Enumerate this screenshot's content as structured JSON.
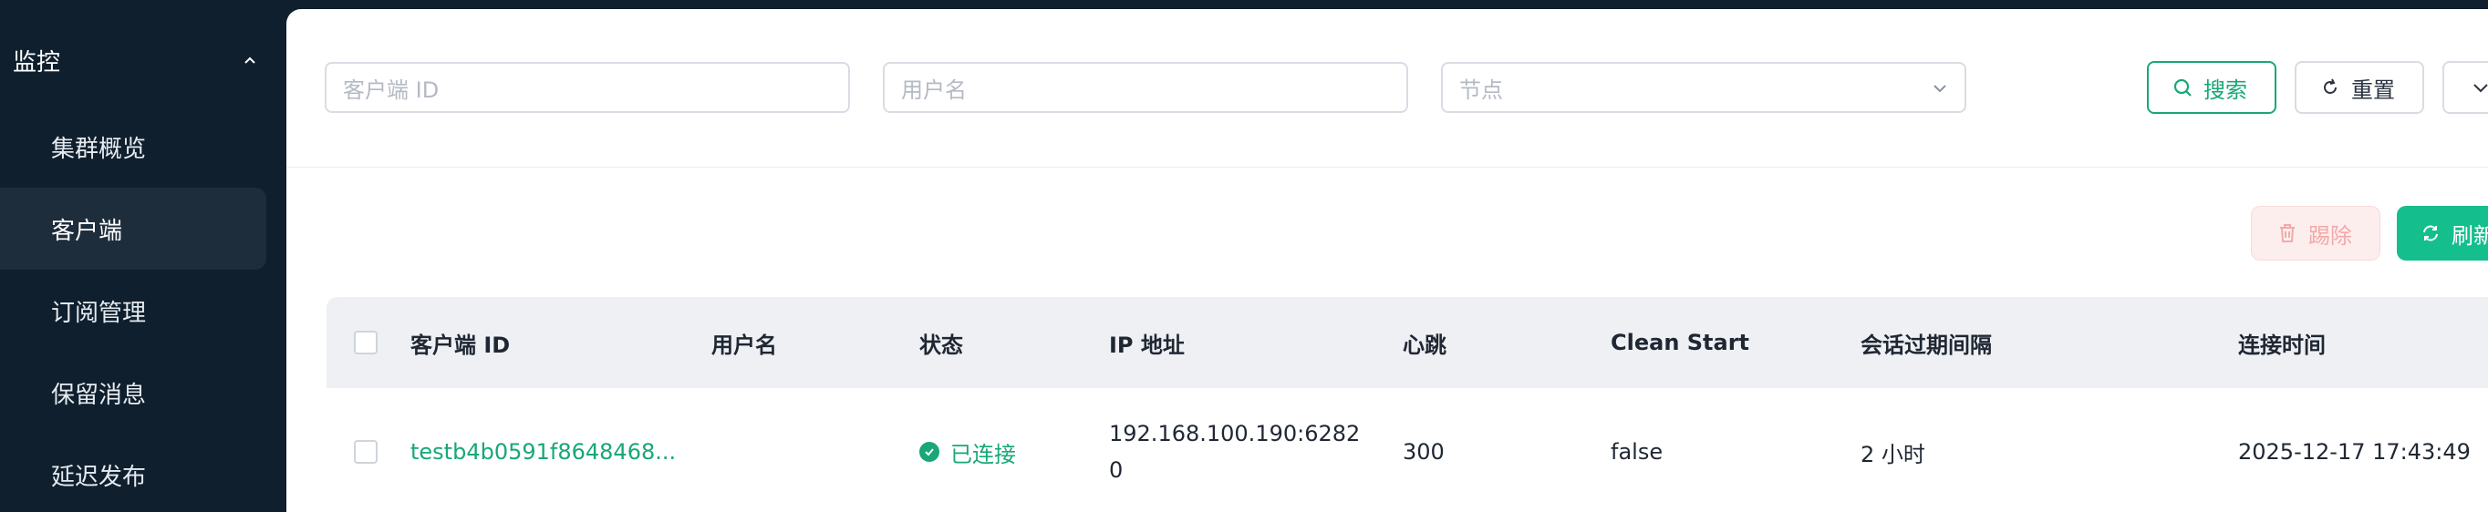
{
  "sidebar": {
    "section_label": "监控",
    "items": [
      {
        "label": "集群概览"
      },
      {
        "label": "客户端"
      },
      {
        "label": "订阅管理"
      },
      {
        "label": "保留消息"
      },
      {
        "label": "延迟发布"
      }
    ]
  },
  "filters": {
    "client_id_placeholder": "客户端 ID",
    "username_placeholder": "用户名",
    "node_placeholder": "节点",
    "search_label": "搜索",
    "reset_label": "重置"
  },
  "toolbar": {
    "kick_label": "踢除",
    "refresh_label": "刷新"
  },
  "table": {
    "columns": [
      "客户端 ID",
      "用户名",
      "状态",
      "IP 地址",
      "心跳",
      "Clean Start",
      "会话过期间隔",
      "连接时间"
    ],
    "rows": [
      {
        "client_id": "testb4b0591f8648468...",
        "username": "",
        "status": "已连接",
        "ip_line1": "192.168.100.190:6282",
        "ip_line2": "0",
        "keepalive": "300",
        "clean_start": "false",
        "expiry": "2 小时",
        "connected_at": "2025-12-17 17:43:49"
      }
    ]
  },
  "colors": {
    "accent": "#17a876",
    "sidebar_bg": "#0f1f2e",
    "danger_light": "#f3a9a9"
  }
}
